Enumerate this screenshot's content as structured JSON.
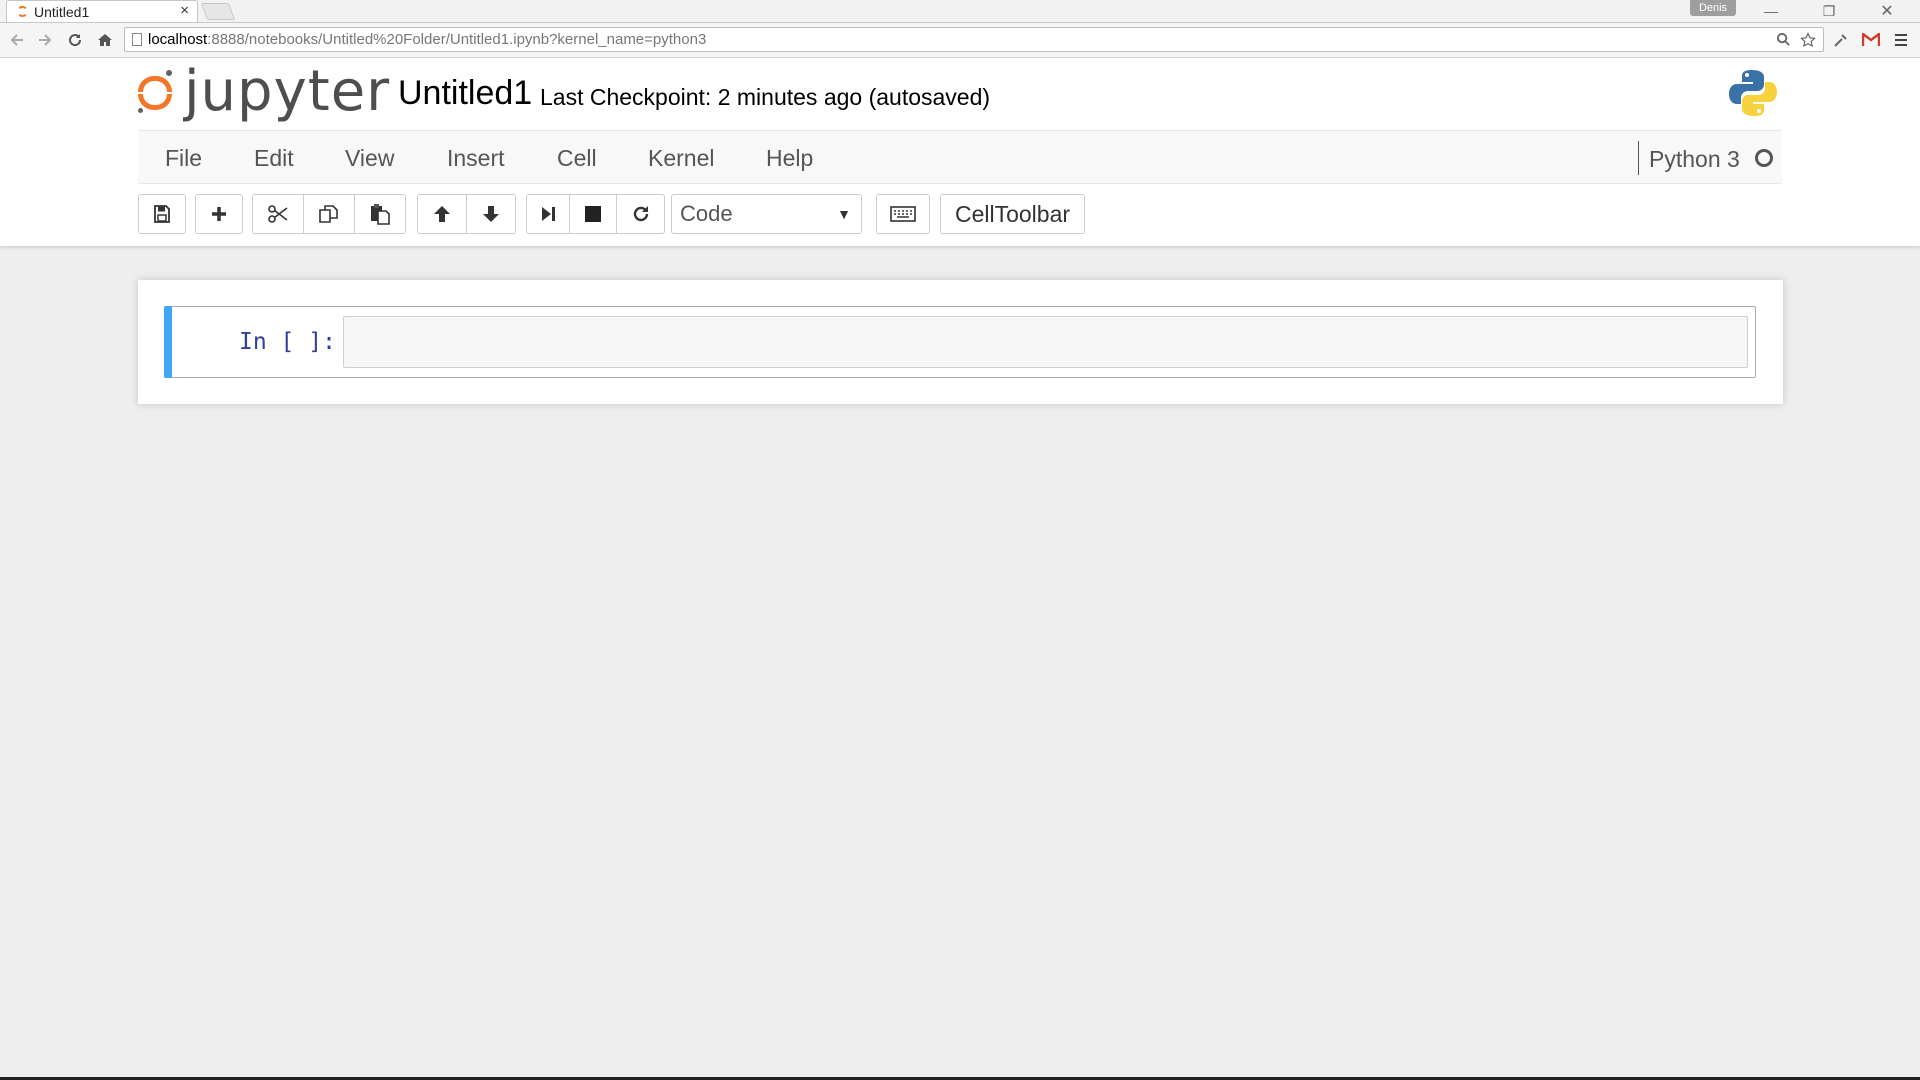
{
  "browser": {
    "tab_title": "Untitled1",
    "tab_close": "×",
    "user": "Denis",
    "window_min": "—",
    "window_max": "❐",
    "window_close": "✕",
    "url_host": "localhost",
    "url_rest": ":8888/notebooks/Untitled%20Folder/Untitled1.ipynb?kernel_name=python3",
    "icons": [
      "back-icon",
      "forward-icon",
      "reload-icon",
      "home-icon",
      "page-icon",
      "zoom-icon",
      "star-icon",
      "extension-icon",
      "gmail-icon",
      "menu-icon"
    ]
  },
  "header": {
    "logo_text": "jupyter",
    "notebook_title": "Untitled1",
    "checkpoint": "Last Checkpoint: 2 minutes ago (autosaved)"
  },
  "menu": {
    "items": [
      "File",
      "Edit",
      "View",
      "Insert",
      "Cell",
      "Kernel",
      "Help"
    ],
    "kernel_name": "Python 3"
  },
  "toolbar": {
    "cell_type": "Code",
    "cell_toolbar_label": "CellToolbar",
    "buttons": [
      "save-icon",
      "plus-icon",
      "cut-icon",
      "copy-icon",
      "paste-icon",
      "arrow-up-icon",
      "arrow-down-icon",
      "step-forward-icon",
      "stop-icon",
      "restart-icon",
      "keyboard-icon"
    ]
  },
  "notebook": {
    "cells": [
      {
        "prompt": "In [ ]:",
        "source": ""
      }
    ]
  },
  "colors": {
    "jupyter_orange": "#f37726",
    "cell_selected": "#42a5f5",
    "prompt_blue": "#303f9f"
  }
}
